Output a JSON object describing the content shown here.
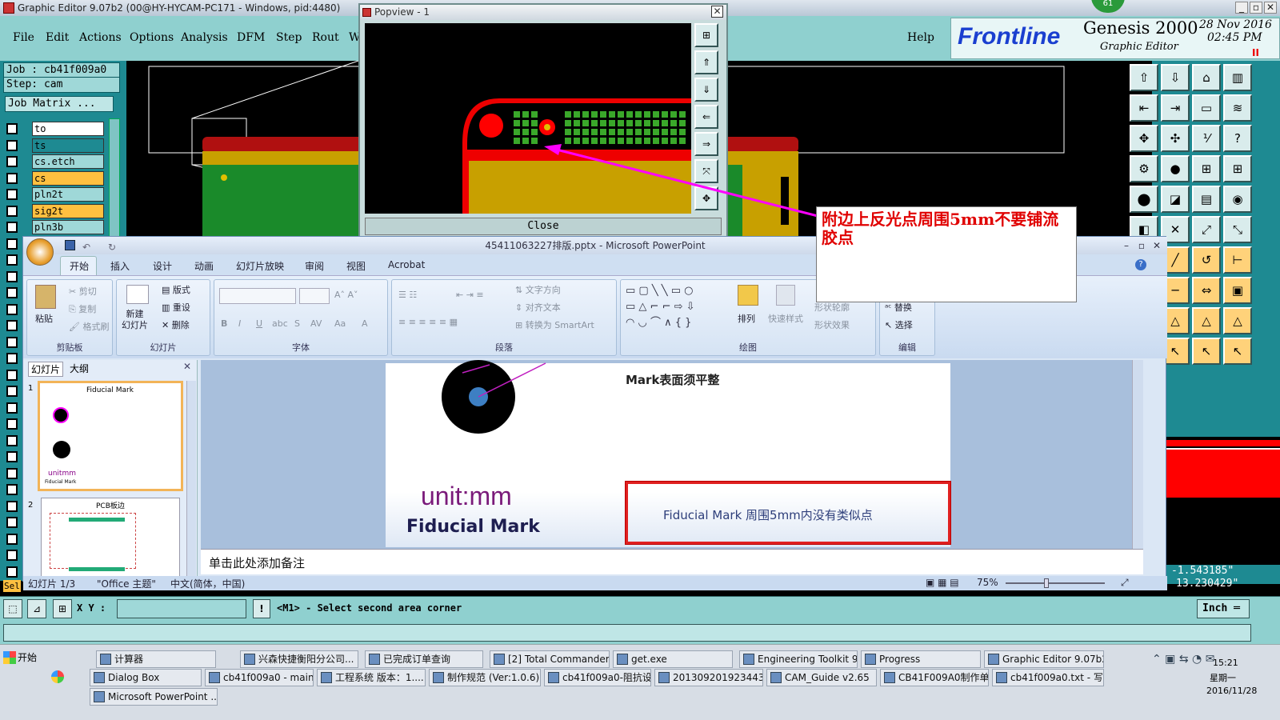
{
  "genesis": {
    "title": "Graphic Editor 9.07b2 (00@HY-HYCAM-PC171 - Windows, pid:4480)",
    "menu": [
      "File",
      "Edit",
      "Actions",
      "Options",
      "Analysis",
      "DFM",
      "Step",
      "Rout",
      "W"
    ],
    "help": "Help",
    "brand": "Frontline",
    "product": "Genesis 2000",
    "subtitle": "Graphic Editor",
    "date": "28 Nov 2016",
    "time": "02:45 PM",
    "badge": "61",
    "job_label": "Job : cb41f009a0",
    "step_label": "Step: cam",
    "job_matrix": "Job Matrix ...",
    "layers": [
      {
        "name": "to",
        "color": "#ffffff"
      },
      {
        "name": "ts",
        "color": "#1e8a92"
      },
      {
        "name": "cs.etch",
        "color": "#9fd8d8"
      },
      {
        "name": "cs",
        "color": "#ffc040"
      },
      {
        "name": "pln2t",
        "color": "#9fd8d8"
      },
      {
        "name": "sig2t",
        "color": "#ffc040"
      },
      {
        "name": "pln3b",
        "color": "#9fd8d8"
      }
    ],
    "coord_x": "-1.543185\"",
    "coord_y": "13.230429\"",
    "xy_label": "X Y :",
    "prompt": "<M1> - Select second area corner",
    "units": "Inch",
    "sel_label": "Sel"
  },
  "popview": {
    "title": "Popview - 1",
    "close": "Close"
  },
  "annotation": {
    "text": "附边上反光点周围5mm不要铺流胶点",
    "arrow_color": "#ff00ff",
    "text_color": "#e00000"
  },
  "ppt": {
    "title": "45411063227排版.pptx - Microsoft PowerPoint",
    "tabs": [
      "开始",
      "插入",
      "设计",
      "动画",
      "幻灯片放映",
      "审阅",
      "视图",
      "Acrobat"
    ],
    "groups": {
      "clipboard": {
        "label": "剪贴板",
        "paste": "粘贴",
        "cut": "剪切",
        "copy": "复制",
        "painter": "格式刷"
      },
      "slides": {
        "label": "幻灯片",
        "new": "新建\n幻灯片",
        "layout": "版式",
        "reset": "重设",
        "delete": "删除"
      },
      "font": {
        "label": "字体"
      },
      "paragraph": {
        "label": "段落",
        "dir": "文字方向",
        "align": "对齐文本",
        "smartart": "转换为 SmartArt"
      },
      "drawing": {
        "label": "绘图",
        "arrange": "排列",
        "quickstyle": "快速样式",
        "outline": "形状轮廓",
        "effect": "形状效果"
      },
      "editing": {
        "label": "编辑",
        "replace": "替换",
        "select": "选择"
      }
    },
    "pane_tabs": [
      "幻灯片",
      "大纲"
    ],
    "thumb1": {
      "num": "1",
      "title": "Fiducial Mark",
      "unit": "unitmm",
      "foot": "Fiducial Mark"
    },
    "thumb2": {
      "num": "2",
      "title": "PCB板边"
    },
    "slide": {
      "text_top": "Mark表面须平整",
      "unit": "unit:mm",
      "heading": "Fiducial Mark",
      "boxed": "Fiducial  Mark 周围5mm内没有类似点"
    },
    "notes": "单击此处添加备注",
    "status": {
      "slide": "幻灯片 1/3",
      "theme": "\"Office 主题\"",
      "lang": "中文(简体，中国)",
      "zoom": "75%"
    }
  },
  "taskbar": {
    "start": "开始",
    "row1": [
      "计算器",
      "兴森快捷衡阳分公司...",
      "已完成订单查询",
      "[2] Total Commander 7....",
      "get.exe",
      "Engineering Toolkit 9.07...",
      "Progress",
      "Graphic Editor 9.07b2 (..."
    ],
    "row2": [
      "Dialog Box",
      "cb41f009a0 - main_qa",
      "工程系统  版本：1....",
      "制作规范 (Ver:1.0.6)",
      "cb41f009a0-阻抗设...",
      "20130920192344327...",
      "CAM_Guide v2.65",
      "CB41F009A0制作单....",
      "cb41f009a0.txt - 写..."
    ],
    "row3": [
      "Microsoft PowerPoint ..."
    ],
    "clock": "15:21",
    "weekday": "星期一",
    "date": "2016/11/28"
  }
}
